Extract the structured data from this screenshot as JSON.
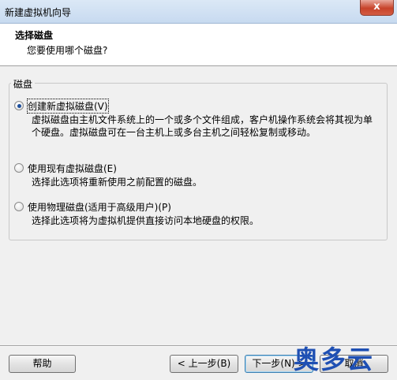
{
  "window": {
    "title": "新建虚拟机向导",
    "close_glyph": "x"
  },
  "header": {
    "title": "选择磁盘",
    "subtitle": "您要使用哪个磁盘?"
  },
  "group": {
    "label": "磁盘"
  },
  "options": [
    {
      "label": "创建新虚拟磁盘(V)",
      "description": "虚拟磁盘由主机文件系统上的一个或多个文件组成，客户机操作系统会将其视为单个硬盘。虚拟磁盘可在一台主机上或多台主机之间轻松复制或移动。",
      "selected": true
    },
    {
      "label": "使用现有虚拟磁盘(E)",
      "description": "选择此选项将重新使用之前配置的磁盘。",
      "selected": false
    },
    {
      "label": "使用物理磁盘(适用于高级用户)(P)",
      "description": "选择此选项将为虚拟机提供直接访问本地硬盘的权限。",
      "selected": false
    }
  ],
  "buttons": {
    "help": "帮助",
    "back": "< 上一步(B)",
    "next": "下一步(N) >",
    "cancel": "取消"
  },
  "watermark": {
    "text": "奥多云",
    "color": "#1e4fb3"
  }
}
